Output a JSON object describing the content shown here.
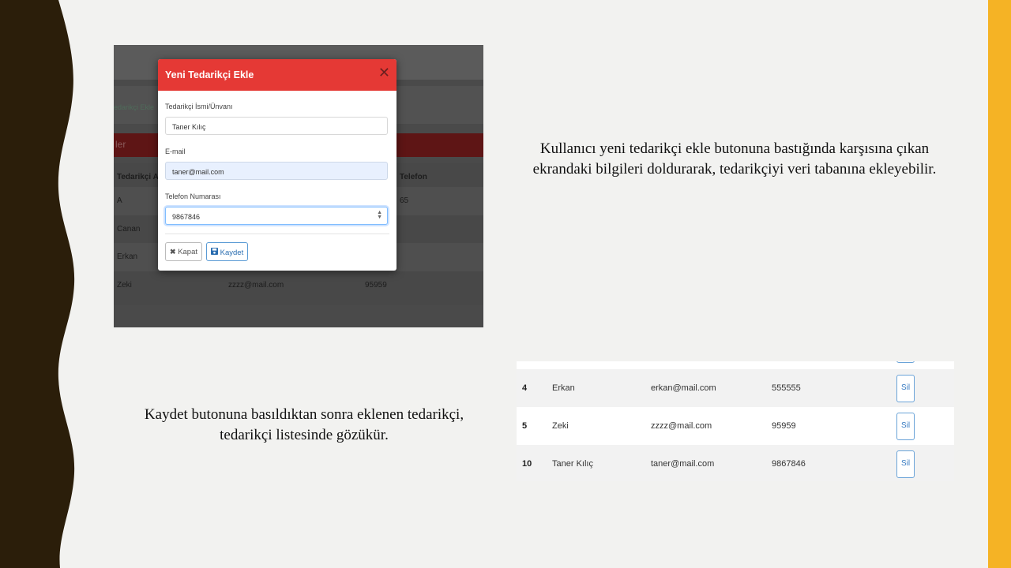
{
  "colors": {
    "background": "#f2f2f0",
    "wave": "#2b1e0a",
    "accent_bar": "#f5b325",
    "modal_header": "#e53935"
  },
  "modal": {
    "title": "Yeni Tedarikçi Ekle",
    "close_icon": "close-icon",
    "fields": [
      {
        "label": "Tedarikçi İsmi/Ünvanı",
        "value": "Taner Kılıç"
      },
      {
        "label": "E-mail",
        "value": "taner@mail.com"
      },
      {
        "label": "Telefon Numarası",
        "value": "9867846"
      }
    ],
    "close_button": "Kapat",
    "save_button": "Kaydet",
    "close_button_icon": "x-icon",
    "save_button_icon": "floppy-disk-icon"
  },
  "background_page": {
    "link_text": "edarikçi Ekle",
    "panel_title": "ler",
    "headers": [
      "Tedarikçi A",
      "Telefon"
    ],
    "rows": [
      {
        "name": "A",
        "email": "",
        "phone": "65"
      },
      {
        "name": "Canan",
        "email": "",
        "phone": ""
      },
      {
        "name": "Erkan",
        "email": "",
        "phone": ""
      },
      {
        "name": "Zeki",
        "email": "zzzz@mail.com",
        "phone": "95959"
      }
    ]
  },
  "caption_top": "Kullanıcı yeni tedarikçi ekle butonuna bastığında karşısına çıkan ekrandaki bilgileri doldurarak, tedarikçiyi veri tabanına ekleyebilir.",
  "caption_bottom": "Kaydet butonuna basıldıktan sonra eklenen tedarikçi, tedarikçi listesinde gözükür.",
  "supplier_table": {
    "delete_label": "Sil",
    "rows": [
      {
        "id": "4",
        "name": "Erkan",
        "email": "erkan@mail.com",
        "phone": "555555"
      },
      {
        "id": "5",
        "name": "Zeki",
        "email": "zzzz@mail.com",
        "phone": "95959"
      },
      {
        "id": "10",
        "name": "Taner Kılıç",
        "email": "taner@mail.com",
        "phone": "9867846"
      }
    ]
  }
}
